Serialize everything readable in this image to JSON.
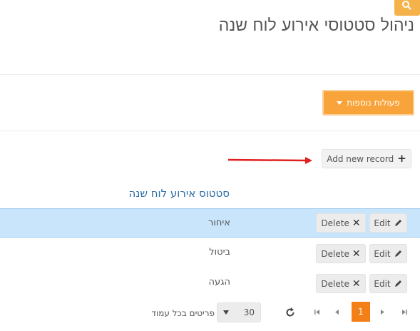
{
  "page": {
    "title": "ניהול סטטוסי אירוע לוח שנה"
  },
  "toolbar": {
    "more_actions_label": "פעולות נוספות",
    "add_record_label": "Add new record"
  },
  "grid": {
    "column_header": "סטטוס אירוע לוח שנה",
    "edit_label": "Edit",
    "delete_label": "Delete",
    "rows": [
      {
        "value": "איחור",
        "selected": true
      },
      {
        "value": "ביטול",
        "selected": false
      },
      {
        "value": "הגעה",
        "selected": false
      }
    ]
  },
  "pager": {
    "page_size": "30",
    "page_size_label": "פריטים בכל עמוד",
    "current_page": "1"
  },
  "colors": {
    "accent": "#f9a43a",
    "selected_row": "#c9e5fb",
    "header_text": "#2e6ea7",
    "current_page": "#f57f17",
    "annotation_arrow": "#e02020"
  },
  "icons": [
    "search-icon",
    "caret-down-icon",
    "plus-icon",
    "delete-x-icon",
    "pencil-icon",
    "refresh-icon",
    "first-page-icon",
    "prev-page-icon",
    "next-page-icon",
    "last-page-icon"
  ]
}
